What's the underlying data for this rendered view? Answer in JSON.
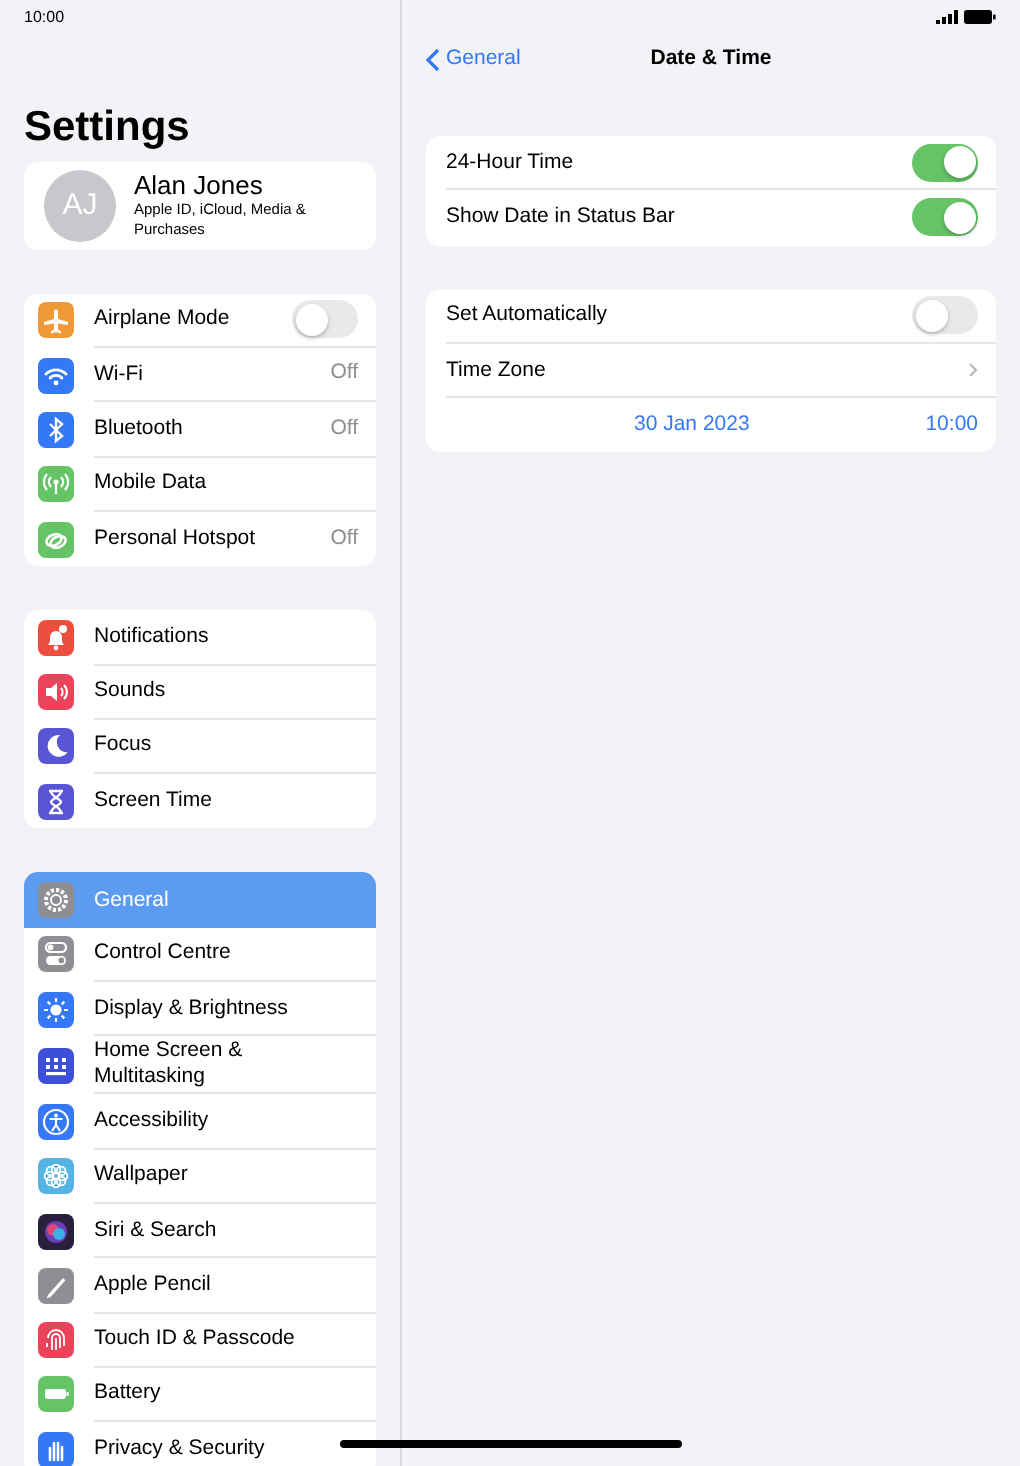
{
  "status_bar": {
    "time": "10:00"
  },
  "sidebar": {
    "title": "Settings",
    "profile": {
      "initials": "AJ",
      "name": "Alan Jones",
      "subtitle": "Apple ID, iCloud, Media & Purchases"
    },
    "groups": [
      {
        "items": [
          {
            "label": "Airplane Mode",
            "kind": "toggle",
            "on": false,
            "color": "#f09a37",
            "selected": false
          },
          {
            "label": "Wi-Fi",
            "kind": "value",
            "value": "Off",
            "color": "#3478f6",
            "selected": false
          },
          {
            "label": "Bluetooth",
            "kind": "value",
            "value": "Off",
            "color": "#3478f6",
            "selected": false
          },
          {
            "label": "Mobile Data",
            "kind": "plain",
            "color": "#65c466",
            "selected": false
          },
          {
            "label": "Personal Hotspot",
            "kind": "value",
            "value": "Off",
            "color": "#65c466",
            "selected": false
          }
        ]
      },
      {
        "items": [
          {
            "label": "Notifications",
            "kind": "plain",
            "color": "#eb4e3d",
            "selected": false
          },
          {
            "label": "Sounds",
            "kind": "plain",
            "color": "#eb445a",
            "selected": false
          },
          {
            "label": "Focus",
            "kind": "plain",
            "color": "#5856d6",
            "selected": false
          },
          {
            "label": "Screen Time",
            "kind": "plain",
            "color": "#5856d6",
            "selected": false
          }
        ]
      },
      {
        "items": [
          {
            "label": "General",
            "kind": "plain",
            "color": "#8e8e93",
            "selected": true
          },
          {
            "label": "Control Centre",
            "kind": "plain",
            "color": "#8e8e93",
            "selected": false
          },
          {
            "label": "Display & Brightness",
            "kind": "plain",
            "color": "#3478f6",
            "selected": false
          },
          {
            "label": "Home Screen & Multitasking",
            "kind": "plain",
            "color": "#3b4fd8",
            "selected": false
          },
          {
            "label": "Accessibility",
            "kind": "plain",
            "color": "#3478f6",
            "selected": false
          },
          {
            "label": "Wallpaper",
            "kind": "plain",
            "color": "#54b5e3",
            "selected": false
          },
          {
            "label": "Siri & Search",
            "kind": "plain",
            "color": "#2a1f3d",
            "selected": false
          },
          {
            "label": "Apple Pencil",
            "kind": "plain",
            "color": "#8e8e93",
            "selected": false
          },
          {
            "label": "Touch ID & Passcode",
            "kind": "plain",
            "color": "#eb445a",
            "selected": false
          },
          {
            "label": "Battery",
            "kind": "plain",
            "color": "#65c466",
            "selected": false
          },
          {
            "label": "Privacy & Security",
            "kind": "plain",
            "color": "#3478f6",
            "selected": false
          }
        ]
      }
    ]
  },
  "detail": {
    "back": "General",
    "title": "Date & Time",
    "groups": [
      {
        "rows": [
          {
            "kind": "toggle",
            "label": "24-Hour Time",
            "on": true
          },
          {
            "kind": "toggle",
            "label": "Show Date in Status Bar",
            "on": true
          }
        ]
      },
      {
        "rows": [
          {
            "kind": "toggle",
            "label": "Set Automatically",
            "on": false
          },
          {
            "kind": "link",
            "label": "Time Zone"
          },
          {
            "kind": "datetime",
            "date": "30 Jan 2023",
            "time": "10:00"
          }
        ]
      }
    ]
  }
}
